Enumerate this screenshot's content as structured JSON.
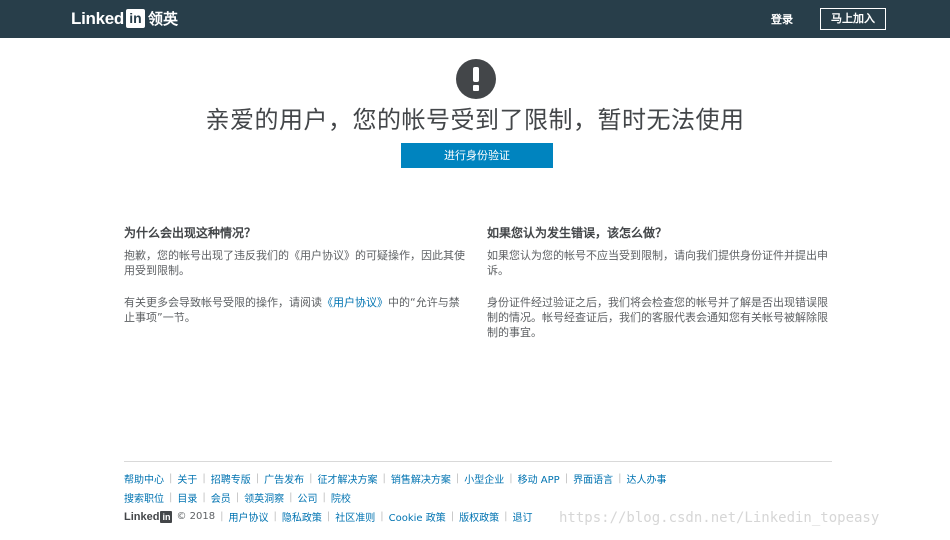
{
  "header": {
    "logo_word": "Linked",
    "logo_box": "in",
    "logo_cn": "领英",
    "signin_label": "登录",
    "join_label": "马上加入"
  },
  "main": {
    "icon": "alert-icon",
    "headline": "亲爱的用户，您的帐号受到了限制，暂时无法使用",
    "verify_button": "进行身份验证"
  },
  "left": {
    "title": "为什么会出现这种情况？",
    "p1": "抱歉，您的帐号出现了违反我们的《用户协议》的可疑操作，因此其使用受到限制。",
    "p2_before": "有关更多会导致帐号受限的操作，请阅读",
    "p2_link": "《用户协议》",
    "p2_after": "中的“允许与禁止事项”一节。"
  },
  "right": {
    "title": "如果您认为发生错误，该怎么做？",
    "p1": "如果您认为您的帐号不应当受到限制，请向我们提供身份证件并提出申诉。",
    "p2": "身份证件经过验证之后，我们将会检查您的帐号并了解是否出现错误限制的情况。帐号经查证后，我们的客服代表会通知您有关帐号被解除限制的事宜。"
  },
  "footer": {
    "row1": [
      "帮助中心",
      "关于",
      "招聘专版",
      "广告发布",
      "征才解决方案",
      "销售解决方案",
      "小型企业",
      "移动 APP",
      "界面语言",
      "达人办事"
    ],
    "row2": [
      "搜索职位",
      "目录",
      "会员",
      "领英洞察",
      "公司",
      "院校"
    ],
    "logo_word": "Linked",
    "logo_box": "in",
    "copyright": "© 2018",
    "row3": [
      "用户协议",
      "隐私政策",
      "社区准则",
      "Cookie 政策",
      "版权政策",
      "退订"
    ]
  },
  "watermark": "https://blog.csdn.net/Linkedin_topeasy",
  "colors": {
    "topbar": "#283e4a",
    "primary_button": "#0084bf",
    "link": "#0073b1"
  }
}
